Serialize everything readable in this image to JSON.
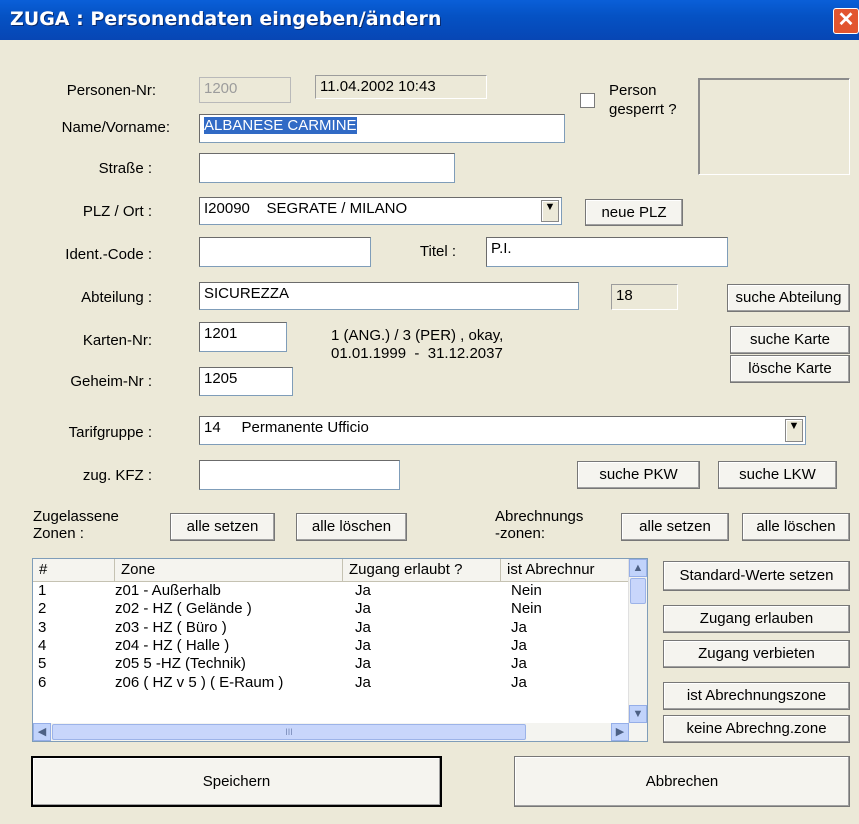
{
  "window": {
    "title": "ZUGA : Personendaten eingeben/ändern",
    "close_glyph": "✕"
  },
  "labels": {
    "personen_nr": "Personen-Nr:",
    "name": "Name/Vorname:",
    "strasse": "Straße :",
    "plz_ort": "PLZ / Ort :",
    "ident": "Ident.-Code :",
    "titel": "Titel :",
    "abteilung": "Abteilung :",
    "karten_nr": "Karten-Nr:",
    "geheim_nr": "Geheim-Nr :",
    "tarifgruppe": "Tarifgruppe :",
    "kfz": "zug. KFZ :",
    "person_gesperrt_1": "Person",
    "person_gesperrt_2": "gesperrt ?",
    "zugelassene_1": "Zugelassene",
    "zugelassene_2": "Zonen :",
    "abrechnung_1": "Abrechnungs",
    "abrechnung_2": "-zonen:"
  },
  "fields": {
    "personen_nr": "1200",
    "datetime": "11.04.2002 10:43",
    "name": "ALBANESE CARMINE",
    "strasse": "",
    "plz_ort": "I20090    SEGRATE / MILANO",
    "ident": "",
    "titel": "P.I.",
    "abteilung": "SICUREZZA",
    "abteilung_nr": "18",
    "karten_nr": "1201",
    "karten_info_1": "1 (ANG.) / 3 (PER) , okay,",
    "karten_info_2": "01.01.1999  -  31.12.2037",
    "geheim_nr": "1205",
    "tarifgruppe": "14     Permanente Ufficio",
    "kfz": ""
  },
  "buttons": {
    "neue_plz": "neue PLZ",
    "suche_abteilung": "suche Abteilung",
    "suche_karte": "suche Karte",
    "loesche_karte": "lösche Karte",
    "suche_pkw": "suche PKW",
    "suche_lkw": "suche LKW",
    "zonen_alle_setzen": "alle setzen",
    "zonen_alle_loeschen": "alle löschen",
    "abr_alle_setzen": "alle setzen",
    "abr_alle_loeschen": "alle löschen",
    "standard_werte": "Standard-Werte setzen",
    "zugang_erlauben": "Zugang erlauben",
    "zugang_verbieten": "Zugang verbieten",
    "ist_abrechnungszone": "ist Abrechnungszone",
    "keine_abrechnungszone": "keine Abrechng.zone",
    "speichern": "Speichern",
    "abbrechen": "Abbrechen"
  },
  "zones": {
    "columns": [
      "#",
      "Zone",
      "Zugang erlaubt ?",
      "ist Abrechnur"
    ],
    "rows": [
      [
        "1",
        "z01 - Außerhalb",
        "Ja",
        "Nein"
      ],
      [
        "2",
        "z02 - HZ  ( Gelände )",
        "Ja",
        "Nein"
      ],
      [
        "3",
        "z03 - HZ  ( Büro )",
        "Ja",
        "Ja"
      ],
      [
        "4",
        "z04 - HZ  ( Halle )",
        "Ja",
        "Ja"
      ],
      [
        "5",
        "z05 5 -HZ  (Technik)",
        "Ja",
        "Ja"
      ],
      [
        "6",
        "z06 ( HZ v 5 ) ( E-Raum )",
        "Ja",
        "Ja"
      ]
    ]
  },
  "icons": {
    "dropdown": "▼",
    "scroll_up": "▲",
    "scroll_down": "▼",
    "scroll_left": "◀",
    "scroll_right": "▶",
    "grip": "III"
  }
}
